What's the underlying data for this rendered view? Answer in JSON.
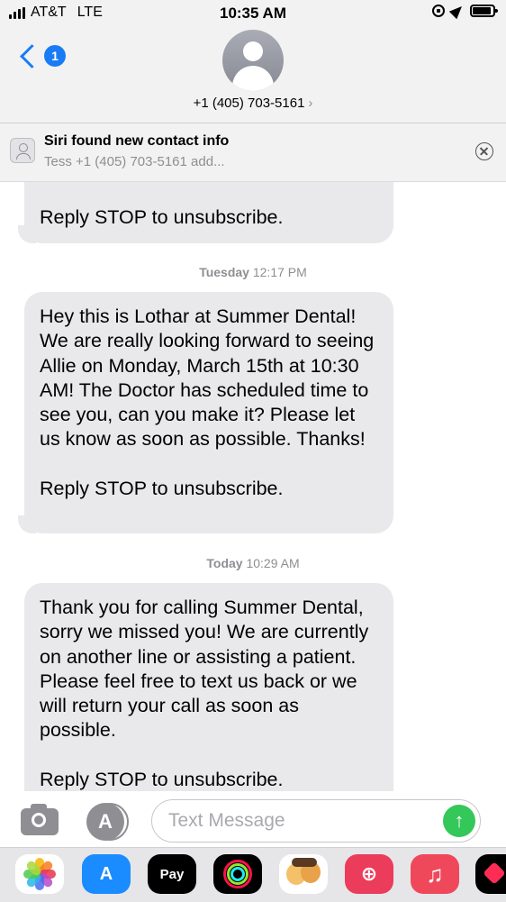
{
  "status_bar": {
    "carrier": "AT&T",
    "network": "LTE",
    "time": "10:35 AM",
    "signal_bars": 4
  },
  "header": {
    "back_badge": "1",
    "contact": "+1 (405) 703-5161",
    "chevron": "›"
  },
  "siri": {
    "title": "Siri found new contact info",
    "subtitle": "Tess +1 (405) 703-5161  add..."
  },
  "messages": [
    {
      "text": "Reply STOP to unsubscribe."
    },
    {
      "timestamp_day": "Tuesday",
      "timestamp_time": "12:17 PM",
      "text": "Hey this is Lothar at Summer Dental! We are really looking forward to seeing Allie on Monday, March 15th at 10:30 AM! The Doctor has scheduled time to see you, can you make it? Please let us know as soon as possible. Thanks!\n\nReply STOP to unsubscribe."
    },
    {
      "timestamp_day": "Today",
      "timestamp_time": "10:29 AM",
      "text": "Thank you for calling Summer Dental, sorry we missed you! We are currently on another line or assisting a patient. Please feel free to text us back or we will return your call as soon as possible.\n\nReply STOP to unsubscribe."
    }
  ],
  "input": {
    "placeholder": "Text Message",
    "send_glyph": "↑"
  },
  "drawer": {
    "pay_label": "Pay",
    "apple_glyph": "",
    "music_glyph": "♫",
    "store_glyph": "A",
    "search_glyph": "⊕"
  },
  "colors": {
    "accent": "#1a7cf5",
    "send": "#34c759",
    "bubble": "#e9e9eb"
  }
}
